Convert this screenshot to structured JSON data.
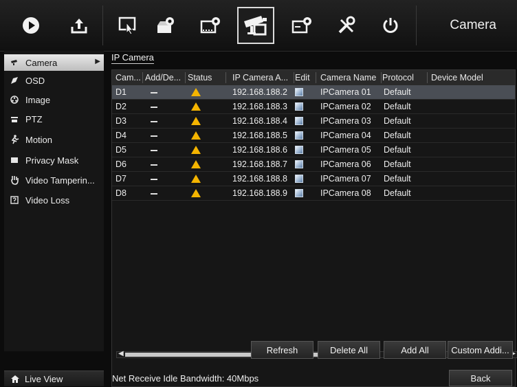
{
  "header": {
    "title": "Camera",
    "toolbar": [
      {
        "name": "play-icon"
      },
      {
        "name": "upload-icon"
      },
      {
        "name": "config-icon"
      },
      {
        "name": "record-settings-icon"
      },
      {
        "name": "storage-settings-icon"
      },
      {
        "name": "camera-icon"
      },
      {
        "name": "event-settings-icon"
      },
      {
        "name": "tools-icon"
      },
      {
        "name": "power-icon"
      }
    ],
    "active_toolbar_index": 5
  },
  "sidebar": {
    "items": [
      {
        "label": "Camera",
        "icon": "camera-icon",
        "active": true
      },
      {
        "label": "OSD",
        "icon": "osd-icon",
        "active": false
      },
      {
        "label": "Image",
        "icon": "image-icon",
        "active": false
      },
      {
        "label": "PTZ",
        "icon": "ptz-icon",
        "active": false
      },
      {
        "label": "Motion",
        "icon": "motion-icon",
        "active": false
      },
      {
        "label": "Privacy Mask",
        "icon": "privacy-mask-icon",
        "active": false
      },
      {
        "label": "Video Tamperin...",
        "icon": "video-tampering-icon",
        "active": false
      },
      {
        "label": "Video Loss",
        "icon": "video-loss-icon",
        "active": false
      }
    ]
  },
  "main": {
    "tab": "IP Camera",
    "table": {
      "columns": [
        "Cam...",
        "Add/De...",
        "Status",
        "IP Camera A...",
        "Edit",
        "Camera Name",
        "Protocol",
        "Device Model"
      ],
      "rows": [
        {
          "cam": "D1",
          "ip": "192.168.188.2",
          "name": "IPCamera 01",
          "protocol": "Default",
          "selected": true
        },
        {
          "cam": "D2",
          "ip": "192.168.188.3",
          "name": "IPCamera 02",
          "protocol": "Default",
          "selected": false
        },
        {
          "cam": "D3",
          "ip": "192.168.188.4",
          "name": "IPCamera 03",
          "protocol": "Default",
          "selected": false
        },
        {
          "cam": "D4",
          "ip": "192.168.188.5",
          "name": "IPCamera 04",
          "protocol": "Default",
          "selected": false
        },
        {
          "cam": "D5",
          "ip": "192.168.188.6",
          "name": "IPCamera 05",
          "protocol": "Default",
          "selected": false
        },
        {
          "cam": "D6",
          "ip": "192.168.188.7",
          "name": "IPCamera 06",
          "protocol": "Default",
          "selected": false
        },
        {
          "cam": "D7",
          "ip": "192.168.188.8",
          "name": "IPCamera 07",
          "protocol": "Default",
          "selected": false
        },
        {
          "cam": "D8",
          "ip": "192.168.188.9",
          "name": "IPCamera 08",
          "protocol": "Default",
          "selected": false
        }
      ]
    },
    "buttons": {
      "refresh": "Refresh",
      "delete_all": "Delete All",
      "add_all": "Add All",
      "custom_add": "Custom Addi..."
    }
  },
  "footer": {
    "live_view": "Live View",
    "status": "Net Receive Idle Bandwidth: 40Mbps",
    "back": "Back"
  },
  "colors": {
    "selected_row": "#4a4e55",
    "warning": "#f4b400",
    "active_sidebar": "#d6d6d6"
  }
}
